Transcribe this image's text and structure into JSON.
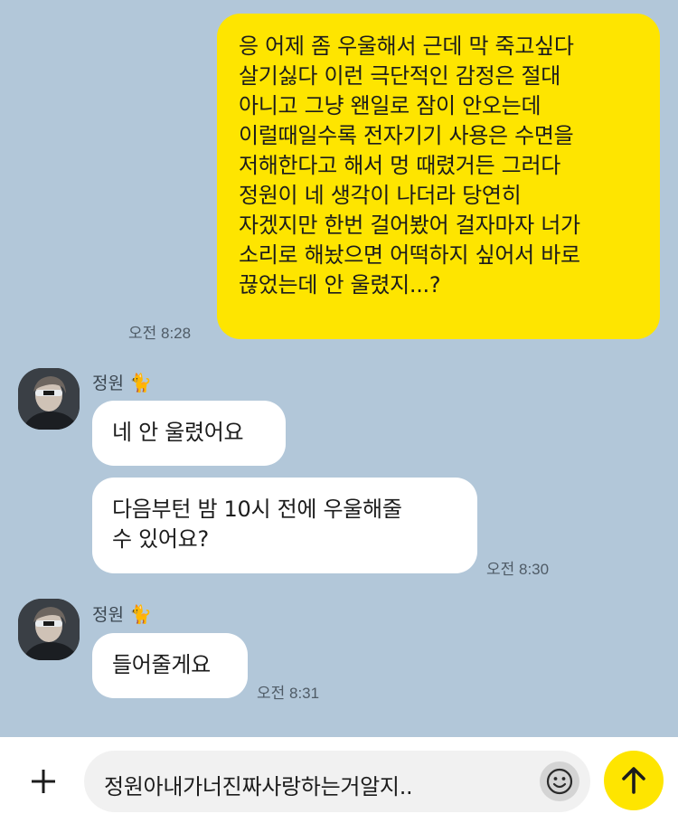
{
  "messages": [
    {
      "from": "me",
      "text": "응 어제 좀 우울해서 근데 막 죽고싶다\n살기싫다 이런 극단적인 감정은 절대\n아니고 그냥 왠일로 잠이 안오는데\n이럴때일수록 전자기기 사용은 수면을\n저해한다고 해서 멍 때렸거든 그러다\n정원이 네 생각이 나더라 당연히\n자겠지만 한번 걸어봤어 걸자마자 너가\n소리로 해놨으면 어떡하지 싶어서 바로\n끊었는데 안 울렸지...?",
      "time": "오전 8:28"
    },
    {
      "from": "them",
      "sender": "정원",
      "sender_emoji": "🐈",
      "bubbles": [
        "네 안 울렸어요",
        "다음부턴 밤 10시 전에 우울해줄\n수 있어요?"
      ],
      "time": "오전 8:30"
    },
    {
      "from": "them",
      "sender": "정원",
      "sender_emoji": "🐈",
      "bubbles": [
        "들어줄게요"
      ],
      "time": "오전 8:31"
    }
  ],
  "composer": {
    "value": "정원아내가너진짜사랑하는거알지..",
    "add_icon": "plus-icon",
    "emoji_icon": "smiley-icon",
    "send_icon": "arrow-up-icon"
  },
  "colors": {
    "background": "#b2c7d9",
    "my_bubble": "#fee500",
    "their_bubble": "#ffffff",
    "send_button": "#fee500"
  }
}
